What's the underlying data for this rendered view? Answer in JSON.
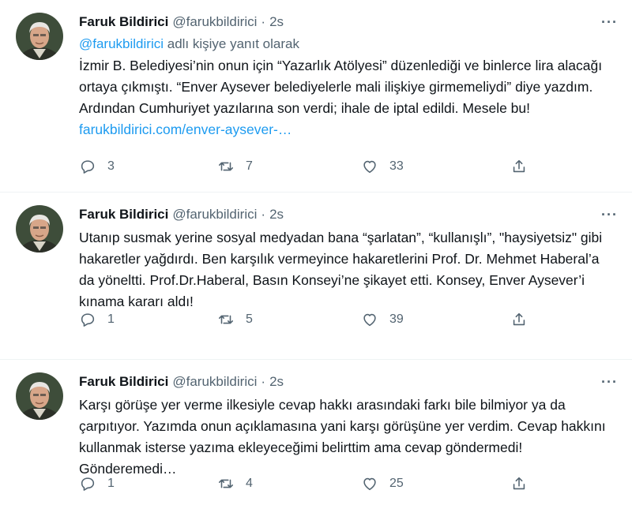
{
  "tweets": [
    {
      "name": "Faruk Bildirici",
      "handle": "@farukbildirici",
      "dot": "·",
      "time": "2s",
      "reply_to": {
        "mention": "@farukbildirici",
        "suffix": " adlı kişiye yanıt olarak"
      },
      "text": "İzmir B. Belediyesi’nin onun için “Yazarlık Atölyesi” düzenlediği ve binlerce lira alacağı ortaya çıkmıştı. “Enver Aysever belediyelerle mali ilişkiye girmemeliydi” diye yazdım. Ardından Cumhuriyet yazılarına son verdi; ihale de iptal edildi. Mesele bu! ",
      "link": "farukbildirici.com/enver-aysever-…",
      "replies": "3",
      "retweets": "7",
      "likes": "33"
    },
    {
      "name": "Faruk Bildirici",
      "handle": "@farukbildirici",
      "dot": "·",
      "time": "2s",
      "text": "Utanıp susmak yerine sosyal medyadan bana “şarlatan”, “kullanışlı”, \"haysiyetsiz\" gibi hakaretler yağdırdı. Ben karşılık vermeyince hakaretlerini Prof. Dr. Mehmet Haberal’a da yöneltti. Prof.Dr.Haberal, Basın Konseyi’ne şikayet etti. Konsey, Enver Aysever’i kınama kararı aldı!",
      "replies": "1",
      "retweets": "5",
      "likes": "39"
    },
    {
      "name": "Faruk Bildirici",
      "handle": "@farukbildirici",
      "dot": "·",
      "time": "2s",
      "text": "Karşı görüşe yer verme ilkesiyle cevap hakkı arasındaki farkı bile bilmiyor ya da çarpıtıyor. Yazımda onun açıklamasına yani karşı görüşüne yer verdim. Cevap hakkını kullanmak isterse yazıma ekleyeceğimi belirttim ama cevap göndermedi! Gönderemedi…",
      "replies": "1",
      "retweets": "4",
      "likes": "25"
    }
  ],
  "more_label": "···",
  "icons": [
    "reply-icon",
    "retweet-icon",
    "like-icon",
    "share-icon"
  ],
  "colors": {
    "link": "#1d9bf0",
    "secondary": "#536471",
    "text": "#0f1419"
  }
}
